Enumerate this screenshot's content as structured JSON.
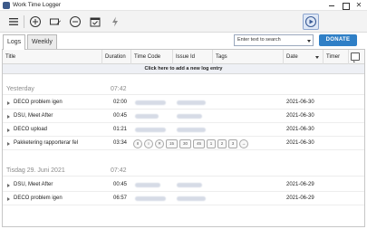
{
  "window": {
    "title": "Work Time Logger"
  },
  "toolbar": {
    "buttons": [
      {
        "name": "menu",
        "icon": "hamburger-icon"
      },
      {
        "name": "add",
        "icon": "plus-circle-icon"
      },
      {
        "name": "edit",
        "icon": "pen-card-icon"
      },
      {
        "name": "remove",
        "icon": "minus-circle-icon"
      },
      {
        "name": "calendar",
        "icon": "calendar-check-icon"
      },
      {
        "name": "quick-action",
        "icon": "lightning-icon"
      },
      {
        "name": "play",
        "icon": "play-circle-icon"
      }
    ]
  },
  "tabs": [
    {
      "label": "Logs",
      "selected": true
    },
    {
      "label": "Weekly Pivot",
      "selected": false
    }
  ],
  "search": {
    "placeholder": "Enter text to search"
  },
  "donate": {
    "label": "DONATE"
  },
  "columns": [
    "Title",
    "Duration",
    "Time Code",
    "Issue Id",
    "Tags",
    "Date",
    "Timer"
  ],
  "add_row_label": "Click here to add a new log entry",
  "groups": [
    {
      "name": "Yesterday",
      "total": "07:42",
      "rows": [
        {
          "title": "DECO problem igen",
          "duration": "02:00",
          "date": "2021-06-30"
        },
        {
          "title": "DSU, Meet After",
          "duration": "00:45",
          "date": "2021-06-30"
        },
        {
          "title": "DECO upload",
          "duration": "01:21",
          "date": "2021-06-30"
        },
        {
          "title": "Pakketering rapporterar fel",
          "duration": "03:34",
          "date": "2021-06-30"
        }
      ]
    },
    {
      "name": "Tisdag 29. Juni 2021",
      "total": "07:42",
      "rows": [
        {
          "title": "DSU, Meet After",
          "duration": "00:45",
          "date": "2021-06-29"
        },
        {
          "title": "DECO problem igen",
          "duration": "06:57",
          "date": "2021-06-29"
        }
      ]
    }
  ],
  "hover_actions": [
    {
      "icon": "pause-icon",
      "label": "II"
    },
    {
      "icon": "stop-icon",
      "label": "○"
    },
    {
      "icon": "cancel-icon",
      "label": "✕"
    },
    {
      "icon": "plus-15-icon",
      "label": "15"
    },
    {
      "icon": "plus-30-icon",
      "label": "30"
    },
    {
      "icon": "plus-45-icon",
      "label": "45"
    },
    {
      "icon": "plus-1-icon",
      "label": "1"
    },
    {
      "icon": "plus-2-icon",
      "label": "2"
    },
    {
      "icon": "plus-3-icon",
      "label": "3"
    },
    {
      "icon": "arrow-right-icon",
      "label": "→"
    }
  ],
  "colors": {
    "accent": "#2f7fc6",
    "toolbar_bg": "#f3f3f3",
    "group_text": "#8a8a8a"
  }
}
